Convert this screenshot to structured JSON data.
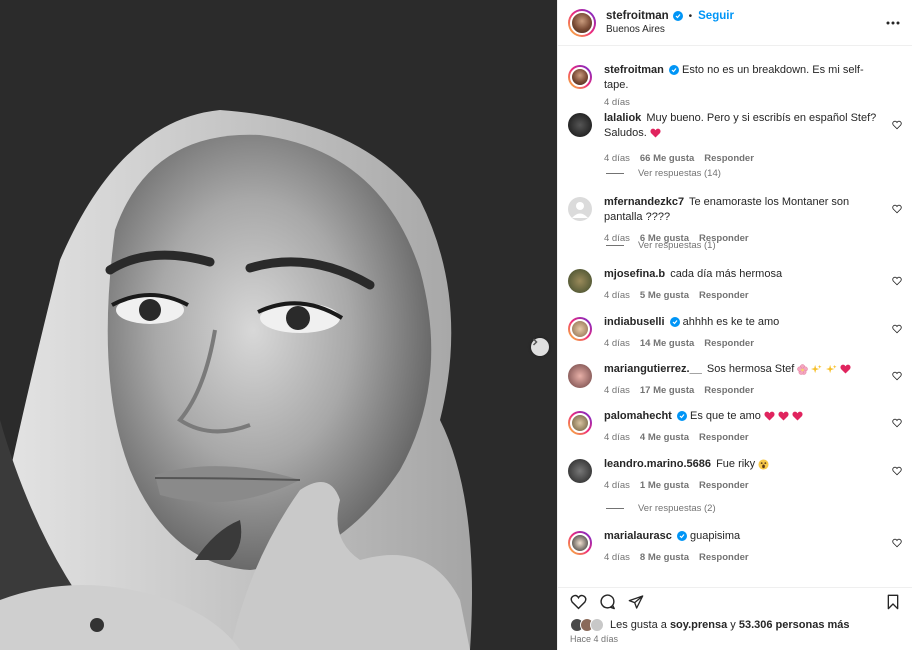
{
  "post": {
    "author": "stefroitman",
    "follow_label": "Seguir",
    "location": "Buenos Aires",
    "caption": "Esto no es un breakdown. Es mi self-tape.",
    "caption_age": "4 días"
  },
  "comments": [
    {
      "user": "lalaliok",
      "verified": false,
      "text": "Muy bueno. Pero y si escribís en español Stef? Saludos.",
      "age": "4 días",
      "likes": "66 Me gusta",
      "reply": "Responder",
      "view_replies": "Ver respuestas (14)"
    },
    {
      "user": "mfernandezkc7",
      "verified": false,
      "text": "Te enamoraste los Montaner son pantalla ????",
      "age": "4 días",
      "likes": "6 Me gusta",
      "reply": "Responder",
      "view_replies": "Ver respuestas (1)"
    },
    {
      "user": "mjosefina.b",
      "verified": false,
      "text": "cada día más hermosa",
      "age": "4 días",
      "likes": "5 Me gusta",
      "reply": "Responder"
    },
    {
      "user": "indiabuselli",
      "verified": true,
      "text": "ahhhh es ke te amo",
      "age": "4 días",
      "likes": "14 Me gusta",
      "reply": "Responder"
    },
    {
      "user": "mariangutierrez.__",
      "verified": false,
      "text": "Sos hermosa Stef",
      "age": "4 días",
      "likes": "17 Me gusta",
      "reply": "Responder"
    },
    {
      "user": "palomahecht",
      "verified": true,
      "text": "Es que te amo",
      "age": "4 días",
      "likes": "4 Me gusta",
      "reply": "Responder"
    },
    {
      "user": "leandro.marino.5686",
      "verified": false,
      "text": "Fue riky",
      "age": "4 días",
      "likes": "1 Me gusta",
      "reply": "Responder",
      "view_replies": "Ver respuestas (2)"
    },
    {
      "user": "marialaurasc",
      "verified": true,
      "text": "guapisima",
      "age": "4 días",
      "likes": "8 Me gusta",
      "reply": "Responder"
    }
  ],
  "footer": {
    "likes_prefix": "Les gusta a",
    "likes_user": "soy.prensa",
    "likes_and": "y",
    "likes_count": "53.306 personas más",
    "posted_ago": "Hace 4 días"
  },
  "colors": {
    "accent": "#0095f6",
    "heart": "#ed4956",
    "muted": "#737373"
  }
}
